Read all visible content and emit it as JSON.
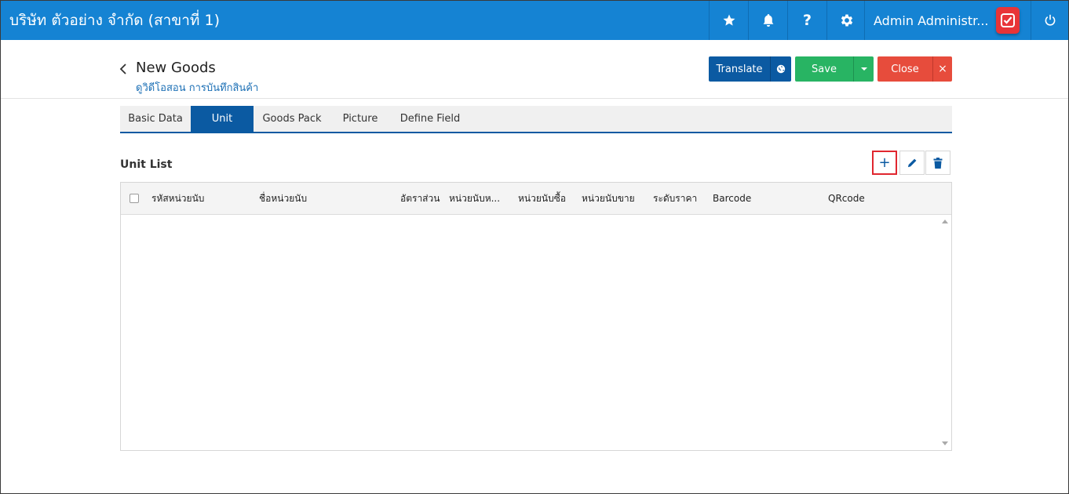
{
  "topbar": {
    "company": "บริษัท ตัวอย่าง จำกัด (สาขาที่ 1)",
    "user": "Admin Administr...",
    "icons": [
      "star-icon",
      "bell-icon",
      "help-icon",
      "gear-icon",
      "app-badge-icon",
      "power-icon"
    ],
    "color": "#1583d3"
  },
  "page": {
    "title": "New Goods",
    "subtitle": "ดูวิดีโอสอน การบันทึกสินค้า"
  },
  "actions": {
    "translate": "Translate",
    "save": "Save",
    "close": "Close",
    "colors": {
      "translate": "#0b5aa2",
      "save": "#28b463",
      "close": "#e74c3c"
    }
  },
  "tabs": [
    {
      "label": "Basic Data",
      "active": false
    },
    {
      "label": "Unit",
      "active": true
    },
    {
      "label": "Goods Pack",
      "active": false
    },
    {
      "label": "Picture",
      "active": false
    },
    {
      "label": "Define Field",
      "active": false
    }
  ],
  "unit_list": {
    "title": "Unit List",
    "tools": [
      "add",
      "edit",
      "delete"
    ],
    "columns": [
      "รหัสหน่วยนับ",
      "ชื่อหน่วยนับ",
      "อัตราส่วน",
      "หน่วยนับห...",
      "หน่วยนับซื้อ",
      "หน่วยนับขาย",
      "ระดับราคา",
      "Barcode",
      "QRcode"
    ],
    "rows": []
  }
}
